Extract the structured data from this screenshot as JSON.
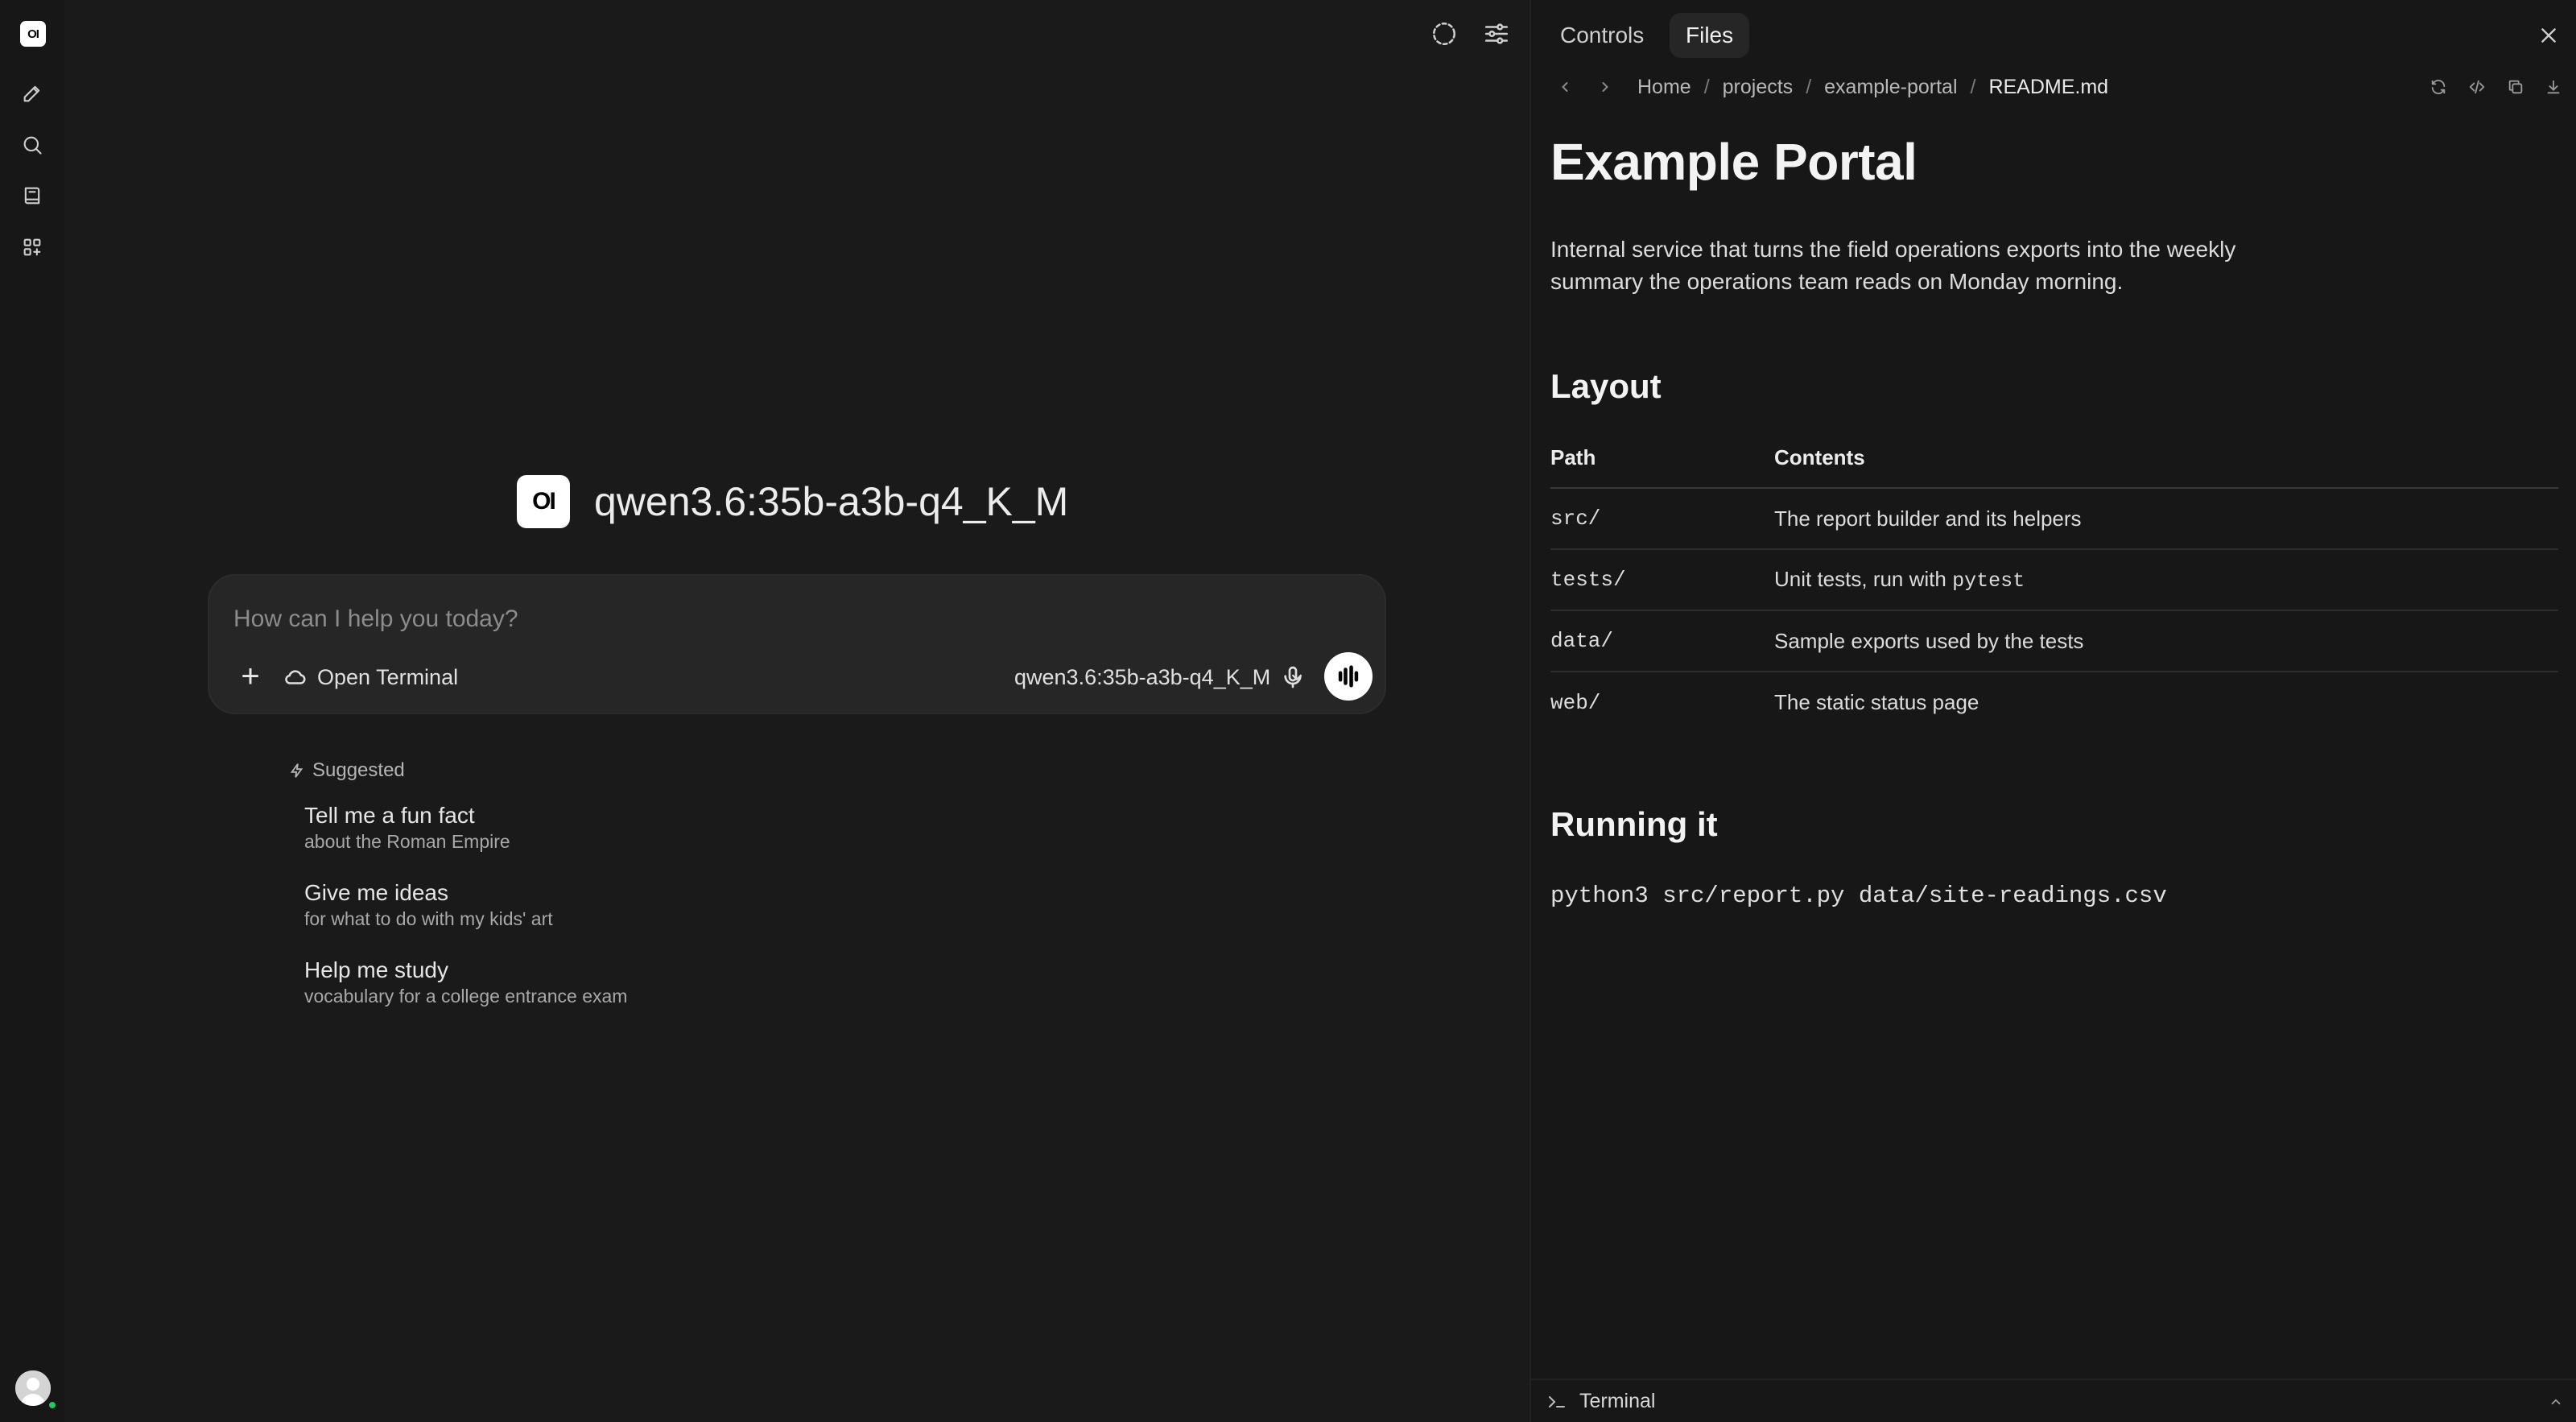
{
  "app": {
    "logo_text": "OI",
    "rail_icons": [
      "edit-icon",
      "search-icon",
      "notebook-icon",
      "apps-icon"
    ],
    "status_color": "#22c55e"
  },
  "chat": {
    "model_title": "qwen3.6:35b-a3b-q4_K_M",
    "composer": {
      "placeholder": "How can I help you today?",
      "value": "",
      "terminal_label": "Open Terminal",
      "model_label": "qwen3.6:35b-a3b-q4_K_M"
    },
    "suggested_label": "Suggested",
    "suggestions": [
      {
        "title": "Tell me a fun fact",
        "subtitle": "about the Roman Empire"
      },
      {
        "title": "Give me ideas",
        "subtitle": "for what to do with my kids' art"
      },
      {
        "title": "Help me study",
        "subtitle": "vocabulary for a college entrance exam"
      }
    ]
  },
  "panel": {
    "tabs": [
      {
        "label": "Controls",
        "active": false
      },
      {
        "label": "Files",
        "active": true
      }
    ],
    "breadcrumbs": [
      "Home",
      "projects",
      "example-portal",
      "README.md"
    ],
    "breadcrumb_sep": "/",
    "doc": {
      "title": "Example Portal",
      "intro": "Internal service that turns the field operations exports into the weekly summary the operations team reads on Monday morning.",
      "layout_heading": "Layout",
      "table": {
        "headers": [
          "Path",
          "Contents"
        ],
        "rows": [
          {
            "path": "src/",
            "contents": "The report builder and its helpers",
            "code": ""
          },
          {
            "path": "tests/",
            "contents": "Unit tests, run with ",
            "code": "pytest"
          },
          {
            "path": "data/",
            "contents": "Sample exports used by the tests",
            "code": ""
          },
          {
            "path": "web/",
            "contents": "The static status page",
            "code": ""
          }
        ]
      },
      "running_heading": "Running it",
      "command": "python3 src/report.py data/site-readings.csv"
    },
    "terminal_label": "Terminal"
  }
}
